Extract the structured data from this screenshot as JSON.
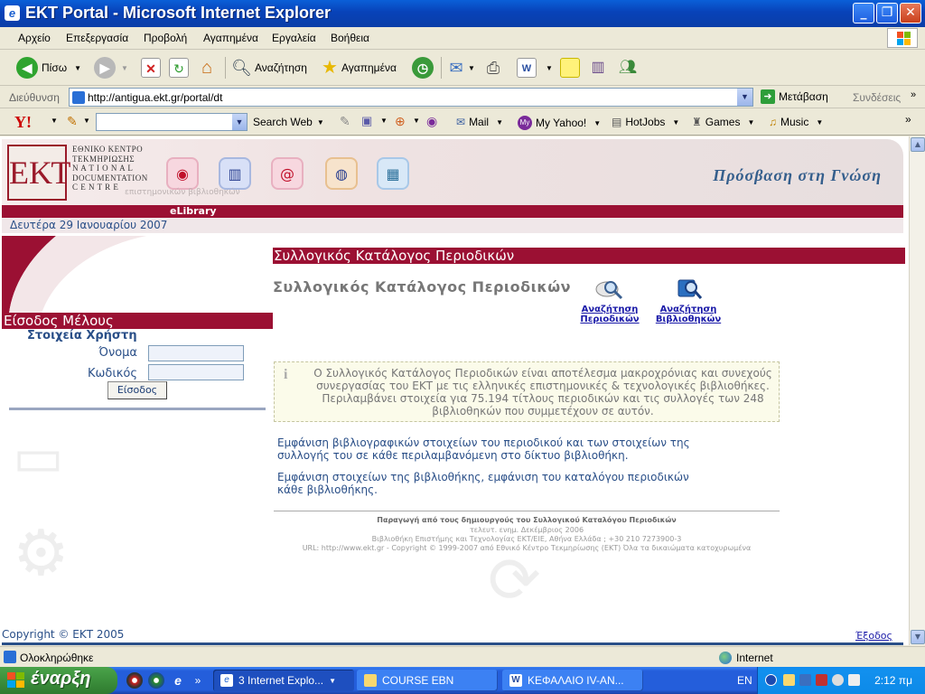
{
  "window": {
    "title": "EKT Portal - Microsoft Internet Explorer",
    "buttons": {
      "minimize": "_",
      "maximize": "❐",
      "close": "✕"
    }
  },
  "menu": [
    "Αρχείο",
    "Επεξεργασία",
    "Προβολή",
    "Αγαπημένα",
    "Εργαλεία",
    "Βοήθεια"
  ],
  "toolbar": {
    "back_label": "Πίσω",
    "search_label": "Αναζήτηση",
    "favorites_label": "Αγαπημένα"
  },
  "address": {
    "label": "Διεύθυνση",
    "url": "http://antigua.ekt.gr/portal/dt",
    "go_label": "Μετάβαση",
    "links_label": "Συνδέσεις"
  },
  "yahoo": {
    "logo": "Y!",
    "search_web": "Search Web",
    "search_value": "",
    "mail": "Mail",
    "my_yahoo": "My Yahoo!",
    "hotjobs": "HotJobs",
    "games": "Games",
    "music": "Music"
  },
  "header": {
    "logo_text": "ΕΚΤ",
    "org_name_el_1": "ΕΘΝΙΚΟ ΚΕΝΤΡΟ",
    "org_name_el_2": "ΤΕΚΜΗΡΙΩΣΗΣ",
    "org_name_en_1": "N A T I O N A L",
    "org_name_en_2": "DOCUMENTATION",
    "org_name_en_3": "C E N T R E",
    "tagline": "επιστημονικών βιβλιοθηκών",
    "slogan": "Πρόσβαση στη Γνώση",
    "section": "eLibrary",
    "date": "Δευτέρα 29 Ιανουαρίου 2007"
  },
  "login": {
    "heading": "Είσοδος Μέλους",
    "subheading": "Στοιχεία Χρήστη",
    "username_label": "Όνομα",
    "password_label": "Κωδικός",
    "username_value": "",
    "password_value": "",
    "button": "Είσοδος"
  },
  "main": {
    "heading": "Συλλογικός Κατάλογος Περιοδικών",
    "title": "Συλλογικός Κατάλογος Περιοδικών",
    "action_journals_1": "Αναζήτηση",
    "action_journals_2": "Περιοδικών",
    "action_libraries_1": "Αναζήτηση",
    "action_libraries_2": "Βιβλιοθηκών",
    "info_text": "Ο Συλλογικός Κατάλογος Περιοδικών είναι αποτέλεσμα μακροχρόνιας και συνεχούς συνεργασίας του ΕΚΤ με τις ελληνικές επιστημονικές & τεχνολογικές βιβλιοθήκες. Περιλαμβάνει στοιχεία για 75.194 τίτλους περιοδικών και τις συλλογές των 248 βιβλιοθηκών που συμμετέχουν σε αυτόν.",
    "desc_1": "Εμφάνιση βιβλιογραφικών στοιχείων του περιοδικού και των στοιχείων της συλλογής του σε κάθε περιλαμβανόμενη στο δίκτυο βιβλιοθήκη.",
    "desc_2": "Εμφάνιση στοιχείων της βιβλιοθήκης, εμφάνιση του καταλόγου περιοδικών κάθε βιβλιοθήκης.",
    "footer_1": "Παραγωγή από τους δημιουργούς του Συλλογικού Καταλόγου Περιοδικών",
    "footer_2": "τελευτ. ενημ. Δεκέμβριος 2006",
    "footer_3": "Βιβλιοθήκη Επιστήμης και Τεχνολογίας ΕΚΤ/ΕΙΕ, Αθήνα Ελλάδα ; +30 210 7273900-3",
    "footer_4": "URL: http://www.ekt.gr - Copyright © 1999-2007 από Εθνικό Κέντρο Τεκμηρίωσης (ΕΚΤ) Όλα τα δικαιώματα κατοχυρωμένα"
  },
  "page_footer": {
    "copyright": "Copyright © ΕΚΤ 2005",
    "exit": "Έξοδος"
  },
  "status": {
    "text": "Ολοκληρώθηκε",
    "zone": "Internet"
  },
  "taskbar": {
    "start": "έναρξη",
    "tasks": [
      "3 Internet Explo...",
      "COURSE EBN",
      "ΚΕΦΑΛΑΙΟ IV-AN..."
    ],
    "lang": "EN",
    "clock": "2:12 πμ"
  }
}
